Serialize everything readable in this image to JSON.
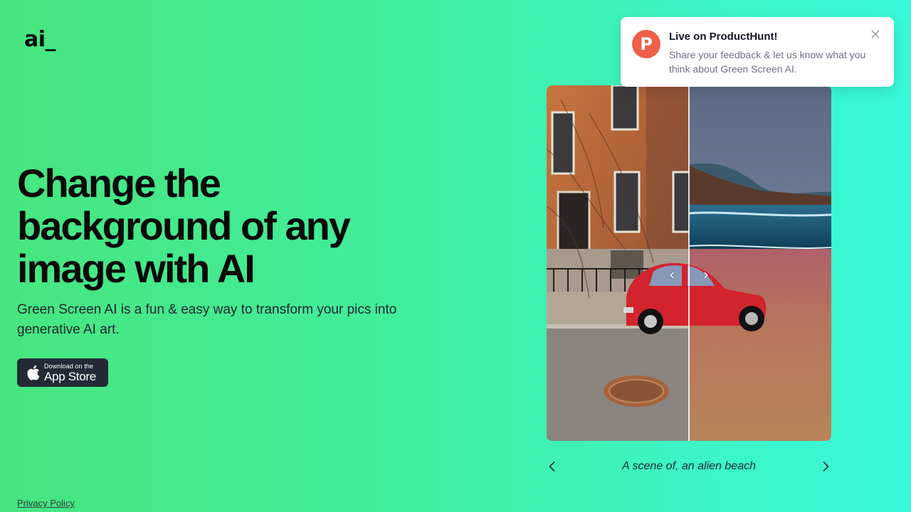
{
  "brand": {
    "logo": "ai_"
  },
  "hero": {
    "headline": "Change the background of any image with AI",
    "subtitle": "Green Screen AI is a fun & easy way to transform your pics into generative AI art."
  },
  "appstore": {
    "small": "Download on the",
    "big": "App Store"
  },
  "footer": {
    "privacy": "Privacy Policy"
  },
  "carousel": {
    "caption": "A scene of, an alien beach"
  },
  "toast": {
    "icon_letter": "P",
    "title": "Live on ProductHunt!",
    "body": "Share your feedback & let us know what you think about Green Screen AI."
  },
  "colors": {
    "gradient_start": "#47e57e",
    "gradient_end": "#38f8d8",
    "producthunt": "#ef5f4a",
    "appstore_bg": "#242a35"
  }
}
